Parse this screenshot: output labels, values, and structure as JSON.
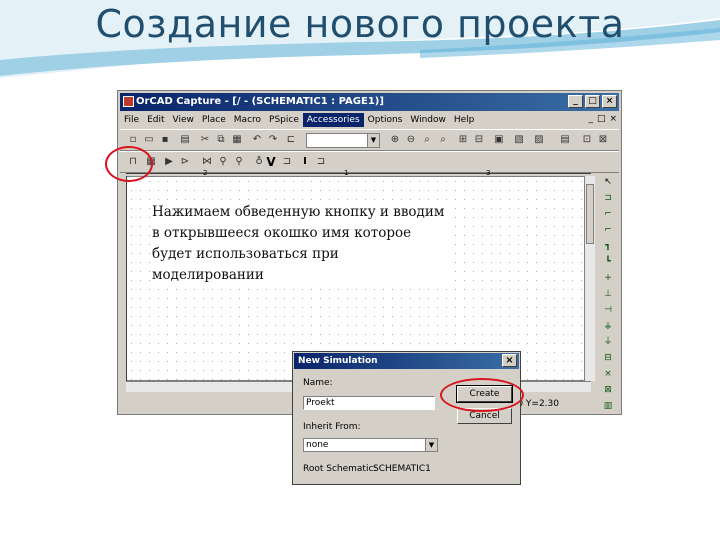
{
  "slide": {
    "title": "Создание нового проекта",
    "instruction": "Нажимаем обведенную кнопку и вводим в открывшееся окошко имя которое будет использоваться при моделировании"
  },
  "app": {
    "title": "OrCAD Capture - [/ - (SCHEMATIC1 : PAGE1)]",
    "window_buttons": [
      "_",
      "□",
      "×"
    ],
    "menu": [
      "File",
      "Edit",
      "View",
      "Place",
      "Macro",
      "PSpice",
      "Accessories",
      "Options",
      "Window",
      "Help"
    ],
    "active_menu": "Accessories",
    "mdi_buttons": [
      "_",
      "□",
      "×"
    ],
    "ruler_marks": [
      "2",
      "1",
      "3"
    ],
    "status_coords": "40  Y=2.30"
  },
  "dialog": {
    "title": "New Simulation",
    "close": "×",
    "name_label": "Name:",
    "name_value": "Proekt",
    "inherit_label": "Inherit From:",
    "inherit_value": "none",
    "root_label": "Root Schematic:",
    "root_value": "SCHEMATIC1",
    "create_label": "Create",
    "cancel_label": "Cancel"
  },
  "colors": {
    "title_text": "#1f4e6e",
    "wave_light": "#cfe8f3",
    "wave_accent": "#5bb0d8",
    "highlight": "#d8141d",
    "titlebar": "#0a246a"
  },
  "icons": {
    "new_simulation_profile": "new-simulation-profile-icon",
    "palette": [
      "select-arrow-icon",
      "part-icon",
      "wire-icon",
      "net-alias-icon",
      "bus-icon",
      "junction-icon",
      "bus-entry-icon",
      "power-icon",
      "ground-icon",
      "off-page-icon",
      "hierarchical-block-icon",
      "port-icon",
      "no-connect-icon",
      "text-icon",
      "line-icon"
    ]
  }
}
